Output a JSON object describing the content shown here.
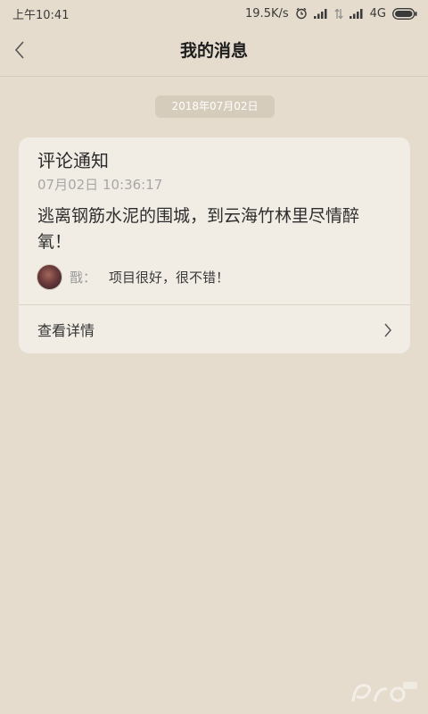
{
  "status_bar": {
    "time": "上午10:41",
    "net_speed": "19.5K/s",
    "network_type": "4G",
    "icons": [
      "alarm-icon",
      "signal-icon",
      "data-arrows-icon",
      "signal-icon",
      "battery-icon"
    ]
  },
  "header": {
    "title": "我的消息",
    "back_icon": "chevron-left-icon"
  },
  "date_chip": "2018年07月02日",
  "card": {
    "title": "评论通知",
    "time": "07月02日 10:36:17",
    "content": "逃离钢筋水泥的围城，到云海竹林里尽情醉氧！",
    "comment": {
      "user": "戬",
      "colon": "：",
      "text": "项目很好，很不错！"
    },
    "detail_label": "查看详情",
    "detail_icon": "chevron-right-icon"
  },
  "colors": {
    "background": "#e5dccd",
    "card": "#f1ede5",
    "date_chip": "#d6ccbc",
    "timestamp": "#a7a7a7"
  }
}
